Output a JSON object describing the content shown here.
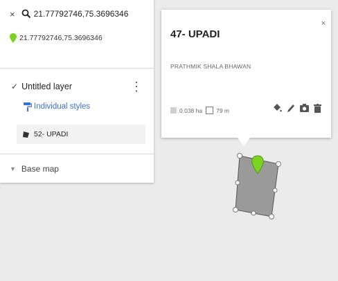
{
  "search": {
    "close_icon": "close-icon",
    "search_icon": "search-icon",
    "query": "21.77792746,75.3696346"
  },
  "location": {
    "icon": "map-pin-icon",
    "coords": "21.77792746,75.3696346"
  },
  "layer": {
    "checkbox": "✓",
    "name": "Untitled layer",
    "styles_label": "Individual styles",
    "feature_label": "52- UPADI"
  },
  "basemap": {
    "label": "Base map"
  },
  "popup": {
    "close": "×",
    "title": "47- UPADI",
    "description": "PRATHMIK SHALA BHAWAN",
    "area": "0.038 ha",
    "perimeter": "79 m"
  },
  "colors": {
    "accent_blue": "#3b6fd4",
    "pin_green": "#7bd321",
    "polygon_fill": "#9a9a9a"
  }
}
